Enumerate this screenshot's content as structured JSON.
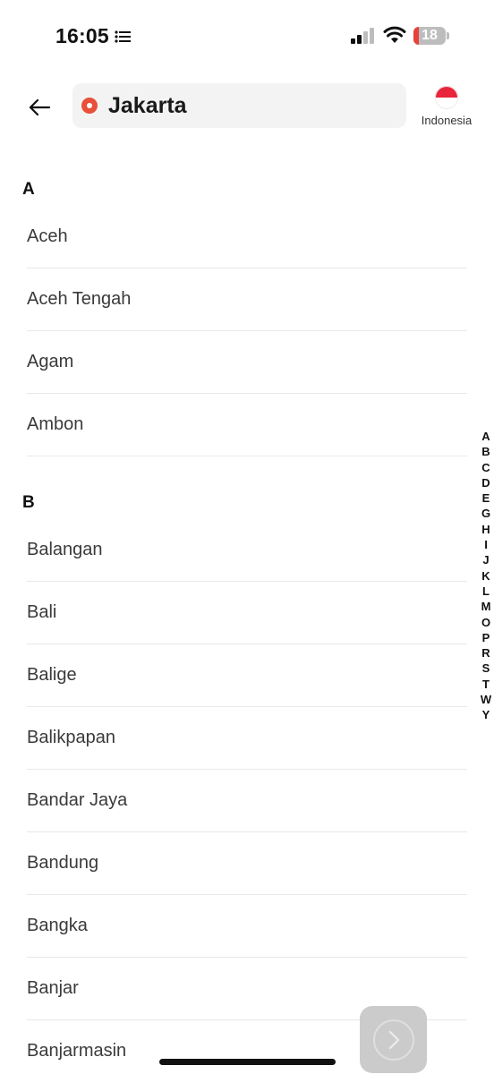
{
  "status": {
    "time": "16:05",
    "battery": "18",
    "battery_percent": 18
  },
  "header": {
    "search_value": "Jakarta",
    "country": "Indonesia"
  },
  "sections": [
    {
      "letter": "A",
      "items": [
        "Aceh",
        "Aceh Tengah",
        "Agam",
        "Ambon"
      ]
    },
    {
      "letter": "B",
      "items": [
        "Balangan",
        "Bali",
        "Balige",
        "Balikpapan",
        "Bandar Jaya",
        "Bandung",
        "Bangka",
        "Banjar",
        "Banjarmasin"
      ]
    }
  ],
  "alphabet_index": [
    "A",
    "B",
    "C",
    "D",
    "E",
    "G",
    "H",
    "I",
    "J",
    "K",
    "L",
    "M",
    "O",
    "P",
    "R",
    "S",
    "T",
    "W",
    "Y"
  ],
  "colors": {
    "accent": "#e8503a",
    "battery_low": "#e8403a"
  },
  "icons": {
    "back": "arrow-left-icon",
    "pin": "location-pin-icon",
    "flag": "indonesia-flag-icon",
    "next": "chevron-right-icon"
  }
}
